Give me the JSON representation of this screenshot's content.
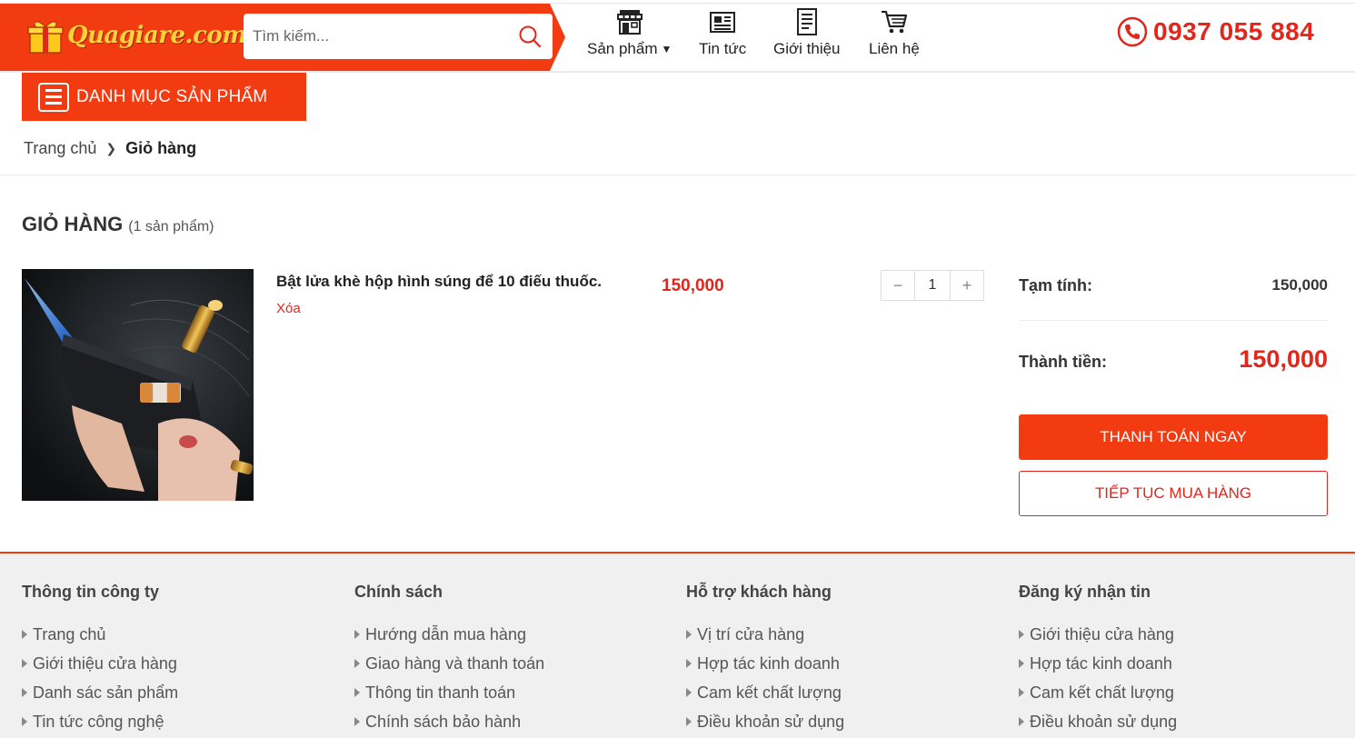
{
  "header": {
    "logo_text": "Quagiare.com",
    "search_placeholder": "Tìm kiếm...",
    "nav": [
      {
        "label": "Sản phẩm",
        "icon": "store-icon"
      },
      {
        "label": "Tin tức",
        "icon": "newspaper-icon"
      },
      {
        "label": "Giới thiệu",
        "icon": "document-icon"
      },
      {
        "label": "Liên hệ",
        "icon": "cart-icon"
      }
    ],
    "phone": "0937 055 884"
  },
  "category_button": {
    "label": "DANH MỤC SẢN PHẨM"
  },
  "breadcrumb": {
    "home": "Trang chủ",
    "current": "Giỏ hàng"
  },
  "cart": {
    "title": "GIỎ HÀNG",
    "count": "(1 sản phẩm)",
    "item": {
      "name": "Bật lửa khè hộp hình súng để 10 điếu thuốc.",
      "remove": "Xóa",
      "price": "150,000",
      "quantity": "1"
    },
    "summary": {
      "subtotal_label": "Tạm tính:",
      "subtotal_value": "150,000",
      "total_label": "Thành tiền:",
      "total_value": "150,000"
    },
    "checkout_label": "THANH TOÁN NGAY",
    "continue_label": "TIẾP TỤC MUA HÀNG"
  },
  "footer": {
    "columns": [
      {
        "title": "Thông tin công ty",
        "items": [
          "Trang chủ",
          "Giới thiệu cửa hàng",
          "Danh sác sản phẩm",
          "Tin tức công nghệ"
        ]
      },
      {
        "title": "Chính sách",
        "items": [
          "Hướng dẫn mua hàng",
          "Giao hàng và thanh toán",
          "Thông tin thanh toán",
          "Chính sách bảo hành"
        ]
      },
      {
        "title": "Hỗ trợ khách hàng",
        "items": [
          "Vị trí cửa hàng",
          "Hợp tác kinh doanh",
          "Cam kết chất lượng",
          "Điều khoản sử dụng"
        ]
      },
      {
        "title": "Đăng ký nhận tin",
        "items": [
          "Giới thiệu cửa hàng",
          "Hợp tác kinh doanh",
          "Cam kết chất lượng",
          "Điều khoản sử dụng"
        ]
      }
    ]
  },
  "colors": {
    "brand": "#f33b12",
    "price": "#e3261c",
    "footer_bg": "#f0f0f0"
  }
}
